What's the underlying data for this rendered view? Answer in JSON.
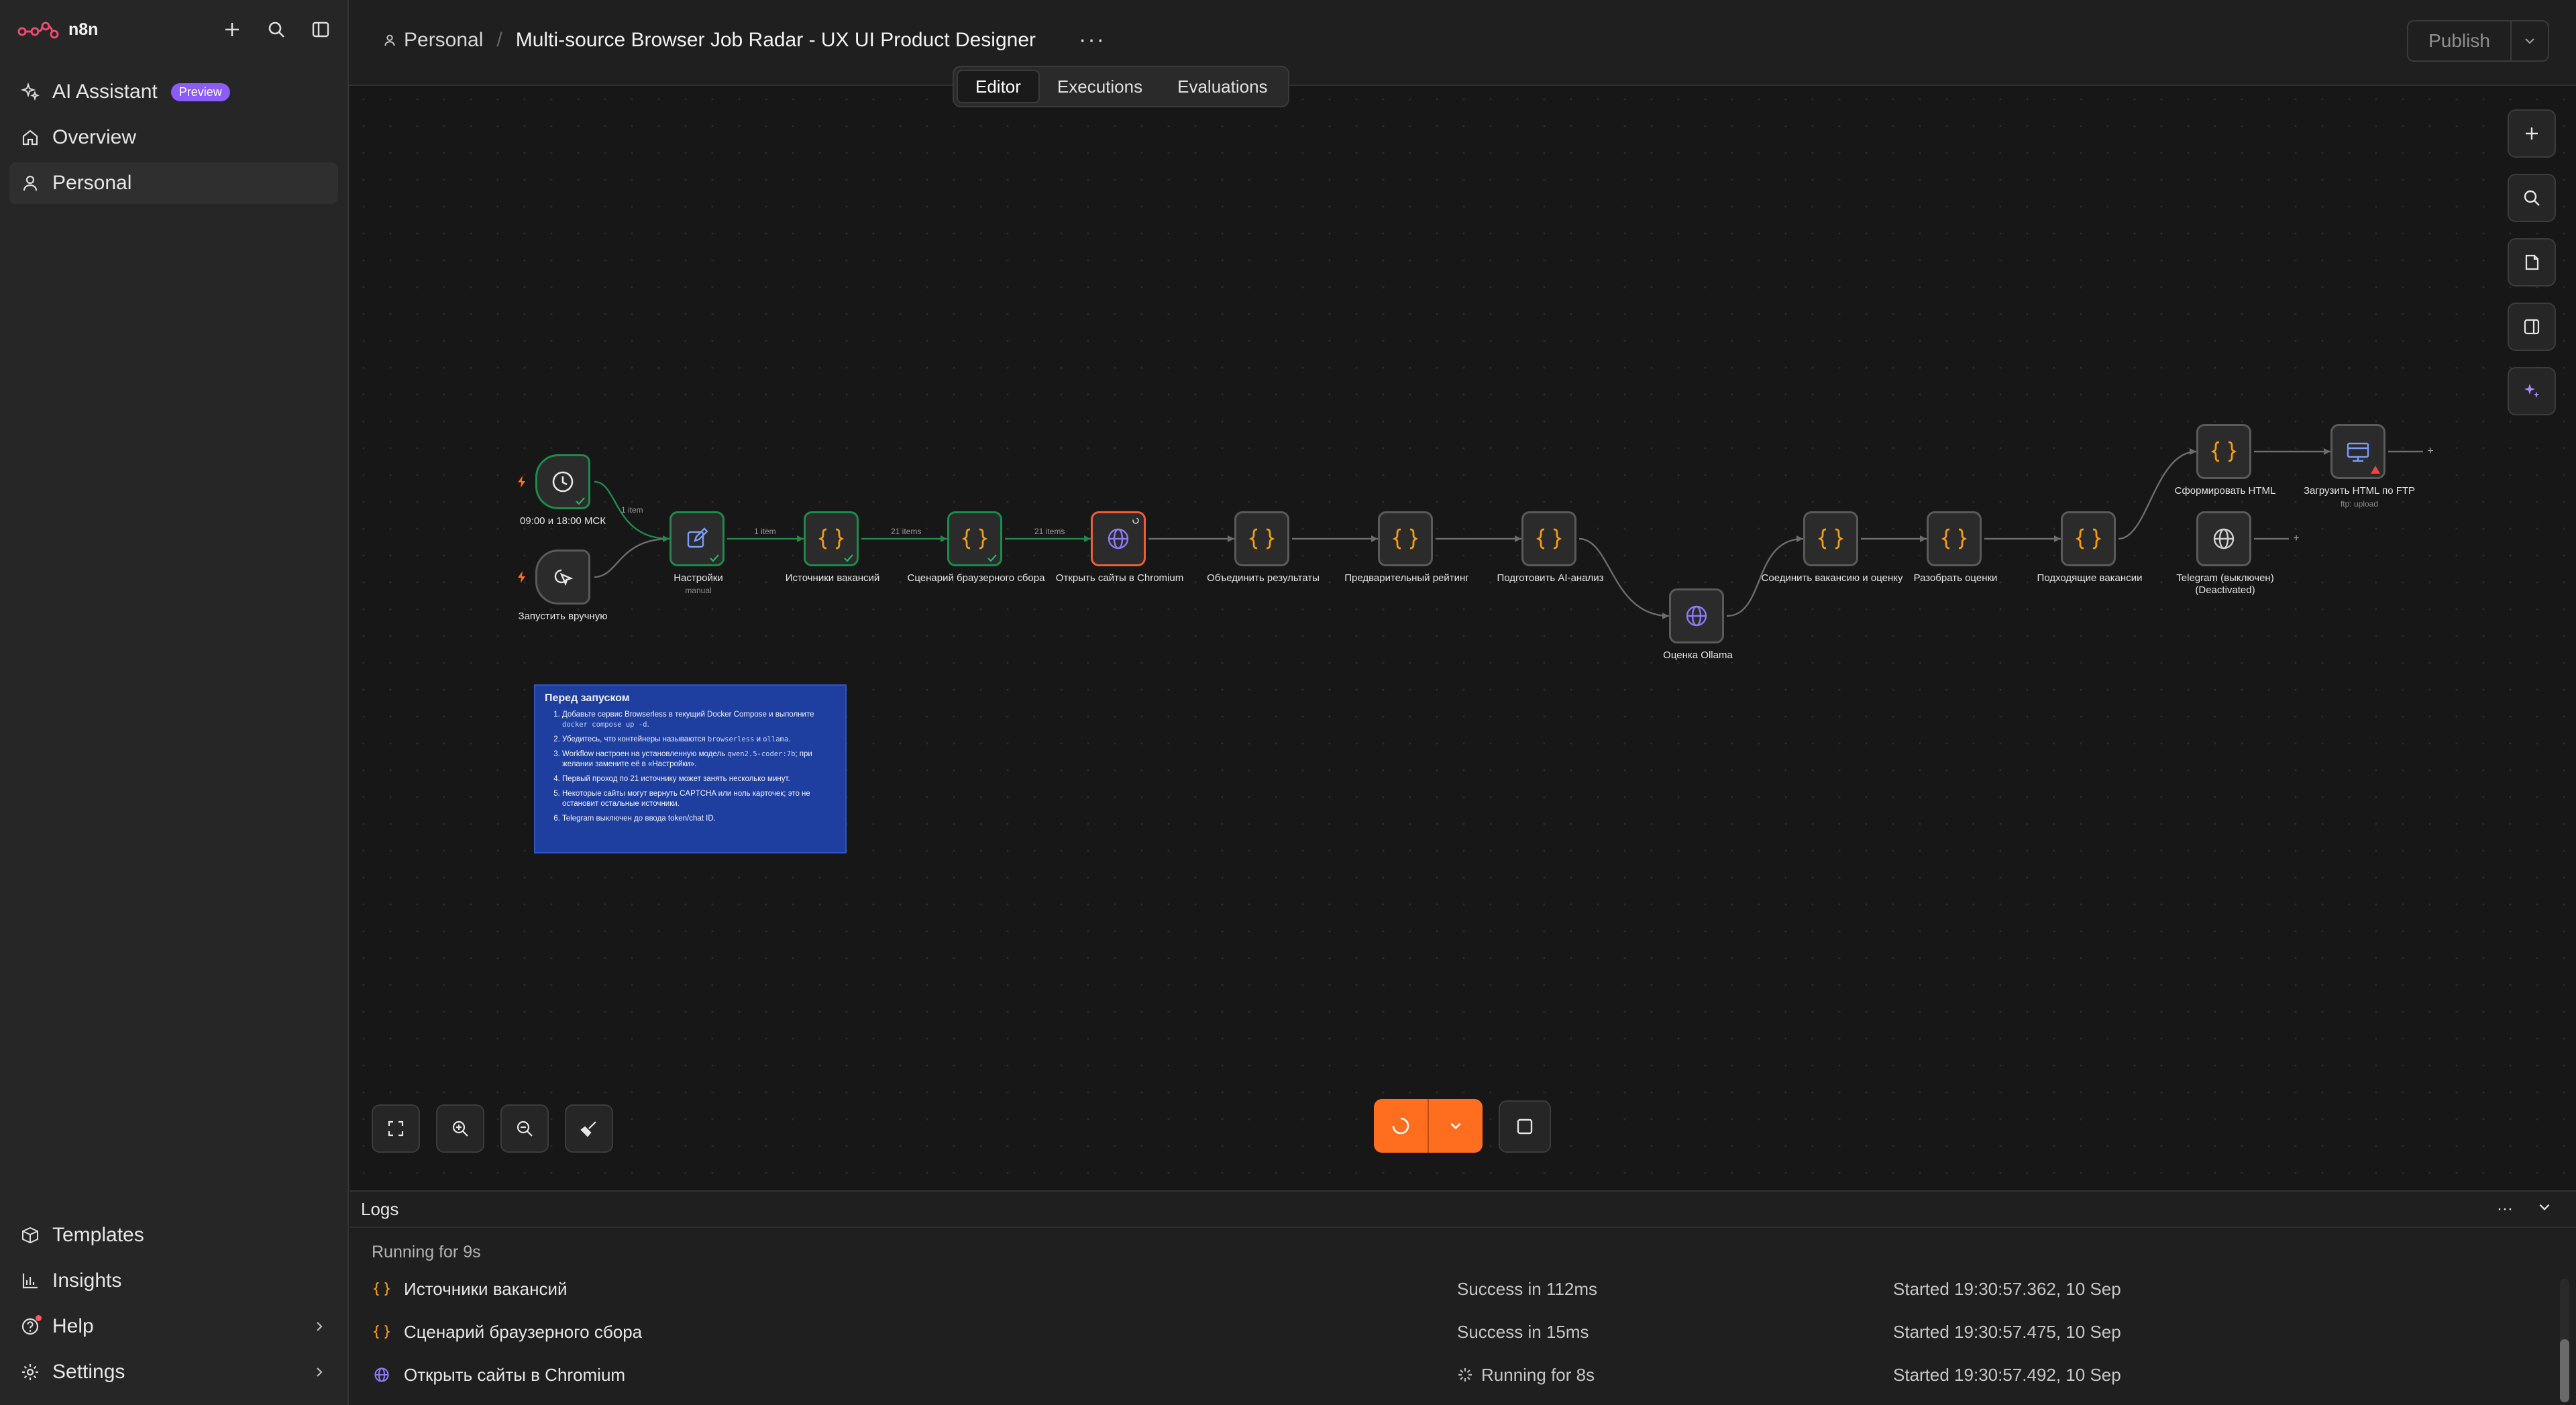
{
  "app": {
    "logo_text": "n8n"
  },
  "sidebar": {
    "items": [
      {
        "label": "AI Assistant",
        "badge": "Preview",
        "icon": "sparkles-icon"
      },
      {
        "label": "Overview",
        "icon": "home-icon"
      },
      {
        "label": "Personal",
        "icon": "user-icon"
      }
    ],
    "bottom": [
      {
        "label": "Templates",
        "icon": "box-icon"
      },
      {
        "label": "Insights",
        "icon": "chart-icon"
      },
      {
        "label": "Help",
        "icon": "help-icon"
      },
      {
        "label": "Settings",
        "icon": "gear-icon"
      }
    ]
  },
  "header": {
    "project": "Personal",
    "separator": "/",
    "workflow_name": "Multi-source Browser Job Radar - UX UI Product Designer",
    "more": "···",
    "publish": "Publish"
  },
  "tabs": [
    "Editor",
    "Executions",
    "Evaluations"
  ],
  "nodes": {
    "schedule": {
      "label": "09:00 и 18:00 МСК"
    },
    "manual": {
      "label": "Запустить вручную"
    },
    "settings": {
      "label": "Настройки",
      "sub": "manual"
    },
    "sources": {
      "label": "Источники вакансий"
    },
    "scenario": {
      "label": "Сценарий браузерного сбора"
    },
    "chromium": {
      "label": "Открыть сайты в Chromium"
    },
    "merge": {
      "label": "Объединить результаты"
    },
    "prerating": {
      "label": "Предварительный рейтинг"
    },
    "prepai": {
      "label": "Подготовить AI-анализ"
    },
    "ollama": {
      "label": "Оценка Ollama"
    },
    "join": {
      "label": "Соединить вакансию и оценку"
    },
    "parse": {
      "label": "Разобрать оценки"
    },
    "suitable": {
      "label": "Подходящие вакансии"
    },
    "html": {
      "label": "Сформировать HTML"
    },
    "ftp": {
      "label": "Загрузить HTML по FTP",
      "sub": "ftp: upload"
    },
    "telegram": {
      "label": "Telegram (выключен) (Deactivated)"
    }
  },
  "edges": {
    "e1": "1 item",
    "e2": "1 item",
    "e3": "21 items",
    "e4": "21 items"
  },
  "sticky": {
    "title": "Перед запуском",
    "items": [
      {
        "a": "Добавьте сервис Browserless в текущий Docker Compose и выполните ",
        "code": "docker compose up -d",
        "b": "."
      },
      {
        "a": "Убедитесь, что контейнеры называются ",
        "code": "browserless",
        "b": " и ",
        "code2": "ollama",
        "c": "."
      },
      {
        "a": "Workflow настроен на установленную модель ",
        "code": "qwen2.5-coder:7b",
        "b": "; при желании замените её в «Настройки»."
      },
      {
        "a": "Первый проход по 21 источнику может занять несколько минут."
      },
      {
        "a": "Некоторые сайты могут вернуть CAPTCHA или ноль карточек; это не остановит остальные источники."
      },
      {
        "a": "Telegram выключен до ввода token/chat ID."
      }
    ]
  },
  "logs": {
    "title": "Logs",
    "status": "Running for 9s",
    "rows": [
      {
        "name": "Источники вакансий",
        "status": "Success in 112ms",
        "started": "Started 19:30:57.362, 10 Sep",
        "icon": "code-braces-icon"
      },
      {
        "name": "Сценарий браузерного сбора",
        "status": "Success in 15ms",
        "started": "Started 19:30:57.475, 10 Sep",
        "icon": "code-braces-icon"
      },
      {
        "name": "Открыть сайты в Chromium",
        "status": "Running for 8s",
        "started": "Started 19:30:57.492, 10 Sep",
        "icon": "globe-icon"
      }
    ]
  },
  "colors": {
    "accent": "#ff6d1f",
    "success": "#1f8a4c",
    "running": "#e8603c",
    "braces": "#f59e0b",
    "globe": "#8b7cf6",
    "sticky": "#1f3fa0",
    "preview_badge": "#8b5cf6"
  }
}
